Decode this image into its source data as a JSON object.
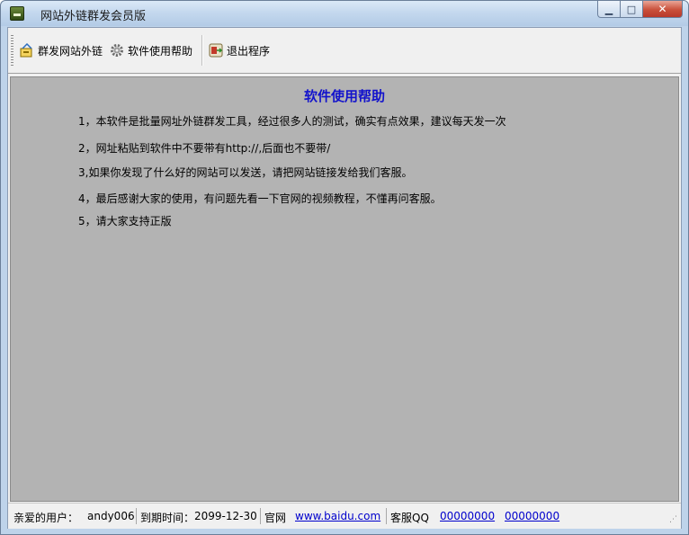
{
  "window": {
    "title": "网站外链群发会员版",
    "minimize_glyph": "▁",
    "maximize_glyph": "□",
    "close_glyph": "✕"
  },
  "toolbar": {
    "items": [
      {
        "label": "群发网站外链",
        "icon": "broadcast-icon"
      },
      {
        "label": "软件使用帮助",
        "icon": "gear-icon"
      },
      {
        "label": "退出程序",
        "icon": "exit-icon"
      }
    ]
  },
  "help": {
    "title": "软件使用帮助",
    "lines": [
      "1，本软件是批量网址外链群发工具，经过很多人的测试，确实有点效果，建议每天发一次",
      "2，网址粘贴到软件中不要带有http://,后面也不要带/",
      "3,如果你发现了什么好的网站可以发送，请把网站链接发给我们客服。",
      "4，最后感谢大家的使用，有问题先看一下官网的视频教程，不懂再问客服。",
      "5，请大家支持正版"
    ]
  },
  "status": {
    "user_label": "亲爱的用户：",
    "user_name": "andy006",
    "expire_label": "到期时间：",
    "expire_date": "2099-12-30",
    "site_label": "官网",
    "site_link": "www.baidu.com ",
    "qq_label": "客服QQ",
    "qq1": "00000000 ",
    "qq2": "00000000 "
  },
  "colors": {
    "help_title": "#1212cc",
    "content_bg": "#b3b3b3",
    "link": "#0000cc"
  }
}
